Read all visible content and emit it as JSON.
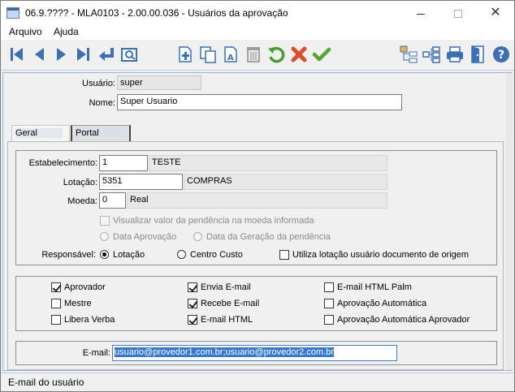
{
  "window": {
    "title": "06.9.???? - MLA0103 - 2.00.00.036 - Usuários da aprovação",
    "minimize_glyph": "",
    "close_glyph": "✕"
  },
  "menu": {
    "items": [
      {
        "label": "Arquivo"
      },
      {
        "label": "Ajuda"
      }
    ]
  },
  "toolbar": {
    "icons": [
      "first-record-icon",
      "previous-record-icon",
      "next-record-icon",
      "last-record-icon",
      "goto-icon",
      "search-icon",
      "new-icon",
      "copy-icon",
      "edit-icon",
      "delete-icon",
      "undo-icon",
      "cancel-icon",
      "confirm-icon",
      "tree-icon",
      "hierarchy-icon",
      "print-icon",
      "exit-icon",
      "help-icon"
    ],
    "colors": {
      "nav": "#3b6fb6",
      "undo": "#4a9d2f",
      "cancel": "#e04a2a",
      "confirm": "#56a632"
    }
  },
  "header": {
    "usuario_label": "Usuário:",
    "usuario_value": "super",
    "nome_label": "Nome:",
    "nome_value": "Super Usuario"
  },
  "tabs": [
    {
      "label": "Geral",
      "active": true
    },
    {
      "label": "Portal",
      "active": false
    }
  ],
  "geral": {
    "estabelecimento_label": "Estabelecimento:",
    "estabelecimento_code": "1",
    "estabelecimento_desc": "TESTE",
    "lotacao_label": "Lotação:",
    "lotacao_code": "5351",
    "lotacao_desc": "COMPRAS",
    "moeda_label": "Moeda:",
    "moeda_code": "0",
    "moeda_desc": "Real",
    "visualizar_label": "Visualizar valor da pendência na moeda informada",
    "data_aprovacao_label": "Data Aprovação",
    "data_geracao_label": "Data da Geração da pendência",
    "responsavel_label": "Responsável:",
    "resp_lotacao_label": "Lotação",
    "resp_centro_label": "Centro Custo",
    "utiliza_lotacao_label": "Utiliza lotação usuário documento de origem",
    "checkboxes": [
      {
        "label": "Aprovador",
        "checked": true
      },
      {
        "label": "Mestre",
        "checked": false
      },
      {
        "label": "Libera Verba",
        "checked": false
      },
      {
        "label": "Envia E-mail",
        "checked": true
      },
      {
        "label": "Recebe E-mail",
        "checked": true
      },
      {
        "label": "E-mail HTML",
        "checked": true
      },
      {
        "label": "E-mail HTML Palm",
        "checked": false
      },
      {
        "label": "Aprovação Automática",
        "checked": false
      },
      {
        "label": "Aprovação Automática Aprovador",
        "checked": false
      }
    ],
    "email_label": "E-mail:",
    "email_value": "usuario@provedor1.com.br;usuario@provedor2.com.br"
  },
  "status": {
    "text": "E-mail do usuário"
  }
}
